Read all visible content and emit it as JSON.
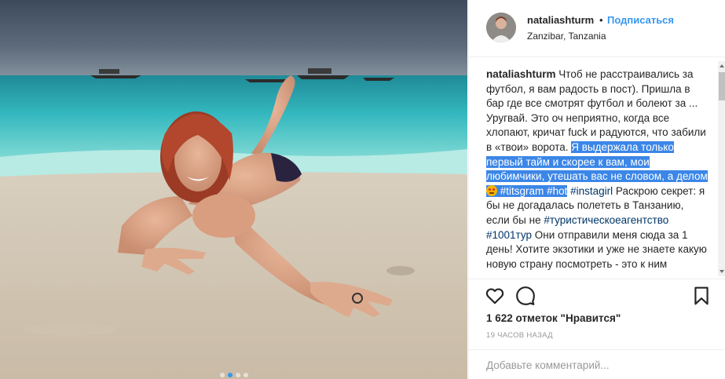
{
  "post": {
    "username": "nataliashturm",
    "separator": "•",
    "follow_label": "Подписаться",
    "location": "Zanzibar, Tanzania",
    "caption": {
      "seg1": "Чтоб не расстраивались за футбол, я вам радость в пост). Пришла в бар где все смотрят футбол и болеют за ... Уругвай. Это оч неприятно, когда все хлопают, кричат fuck и радуются, что забили в «твои» ворота. ",
      "seg2": "Я выдержала только первый тайм и скорее к вам, мои любимчики, утешать вас не словом, а делом",
      "seg3": " ",
      "tag1": "#titsgram",
      "seg4": " ",
      "tag2": "#hot",
      "seg5": " ",
      "tag3": "#instagirl",
      "seg6": " Раскрою секрет: я бы не догадалась полететь в Танзанию, если бы не ",
      "tag4": "#туристическоеагентство",
      "seg7": " ",
      "tag5": "#1001тур",
      "seg8": " Они отправили меня сюда за 1 день! Хотите экзотики и уже не знаете какую новую страну посмотреть - это к ним"
    },
    "likes": "1 622 отметок \"Нравится\"",
    "time_ago": "19 ЧАСОВ НАЗАД",
    "comment_placeholder": "Добавьте комментарий...",
    "carousel": {
      "total": 4,
      "active": 1
    }
  },
  "icons": {
    "like": "heart-icon",
    "comment": "comment-bubble-icon",
    "save": "bookmark-icon",
    "smile": "smiling-face-emoji"
  },
  "colors": {
    "link": "#3897f0",
    "hashtag": "#003569",
    "selection": "#3b86e7",
    "muted": "#999999"
  }
}
